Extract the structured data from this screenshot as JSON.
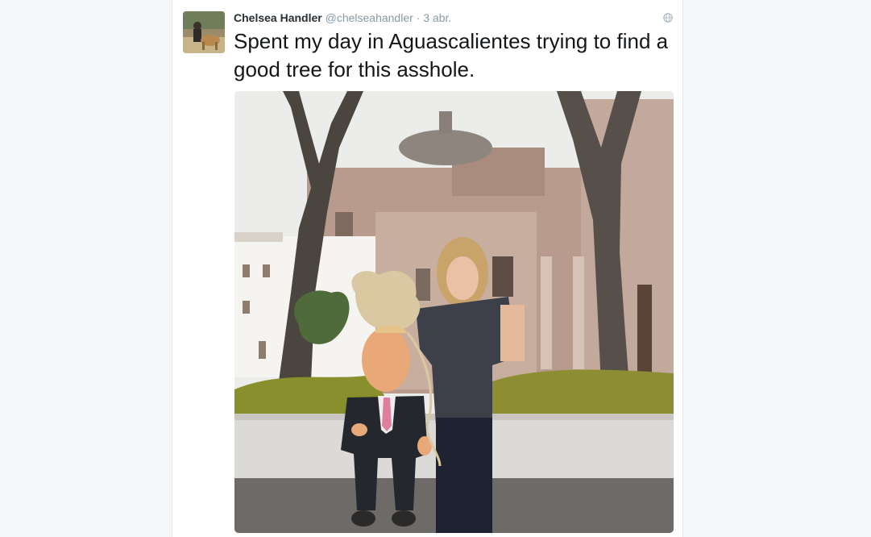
{
  "tweet": {
    "author_name": "Chelsea Handler",
    "author_handle": "@chelseahandler",
    "separator": "·",
    "time": "3 abr.",
    "text": "Spent my day in Aguascalientes trying to find a good tree for this asshole.",
    "visibility_icon": "globe-icon",
    "photo_description": "woman holding a pinata in front of a stone church with trees"
  },
  "colors": {
    "name": "#292f33",
    "meta": "#8899a6",
    "text": "#14171a",
    "background": "#f5f8fa"
  }
}
